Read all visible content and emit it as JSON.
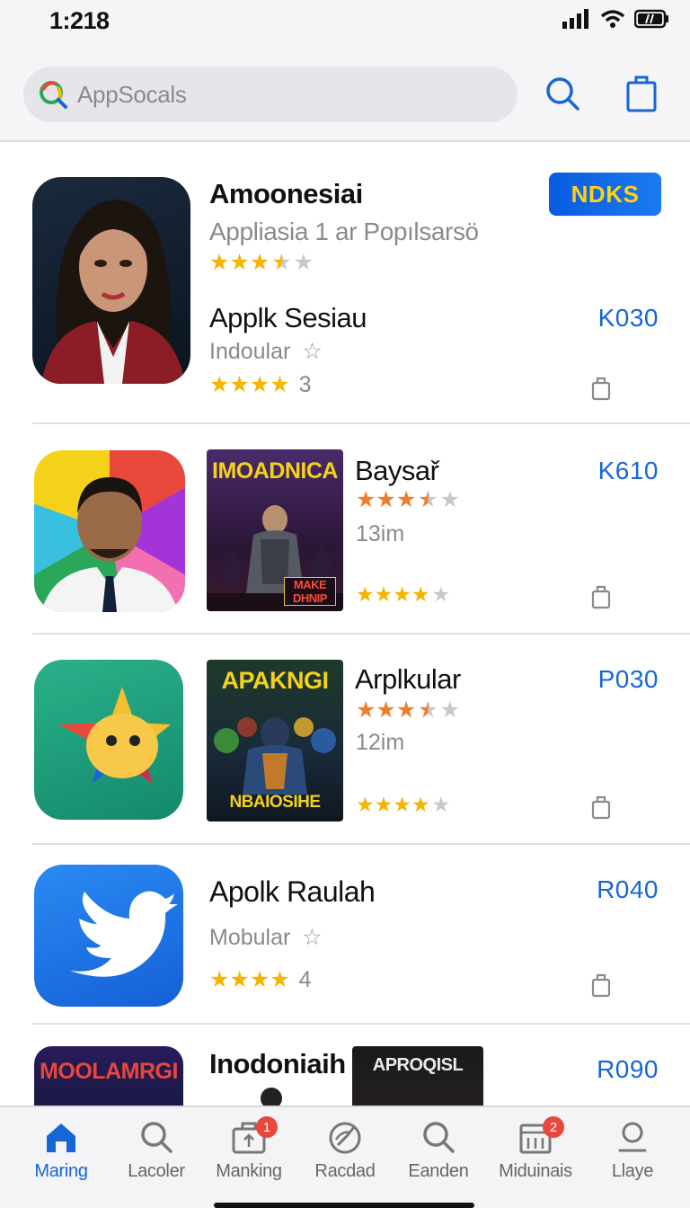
{
  "status": {
    "time": "1:218"
  },
  "search": {
    "text": "AppSocals"
  },
  "colors": {
    "accent": "#1766d6",
    "star_gold": "#f5b400",
    "star_orange": "#f07d2a",
    "badge": "#e8473b"
  },
  "rows": [
    {
      "title": "Amoonesiai",
      "subtitle": "Appliasia 1 ar Popılsarsö",
      "badge": "NDKS",
      "rating": 3.5,
      "secondary_title": "Applk Sesiau",
      "secondary_sub": "Indoular",
      "price": "K030",
      "rating2": 4,
      "rating2_count": "3"
    },
    {
      "poster_title": "IMOADNICA",
      "poster_caption": "MAKE DHNIP",
      "title": "Baysař",
      "rating": 3.5,
      "meta": "13im",
      "rating2": 4,
      "price": "K610"
    },
    {
      "poster_title": "APAKNGI",
      "poster_caption": "NBAIOSIHE",
      "title": "Arplkular",
      "rating": 3.5,
      "meta": "12im",
      "rating2": 4,
      "price": "P030"
    },
    {
      "title": "Apolk Raulah",
      "subtitle": "Mobular",
      "rating": 4,
      "rating_count": "4",
      "price": "R040"
    },
    {
      "poster_title": "MOOLAMRGI",
      "title": "Inodoniaih",
      "poster2_title": "APROQISL",
      "price": "R090"
    }
  ],
  "tabs": [
    {
      "label": "Maring",
      "icon": "home-icon",
      "active": true
    },
    {
      "label": "Lacoler",
      "icon": "search-icon"
    },
    {
      "label": "Manking",
      "icon": "bag-icon",
      "badge": "1"
    },
    {
      "label": "Racdad",
      "icon": "compass-icon"
    },
    {
      "label": "Eanden",
      "icon": "search-icon"
    },
    {
      "label": "Miduinais",
      "icon": "grid-icon",
      "badge": "2"
    },
    {
      "label": "Llaye",
      "icon": "person-icon"
    }
  ]
}
